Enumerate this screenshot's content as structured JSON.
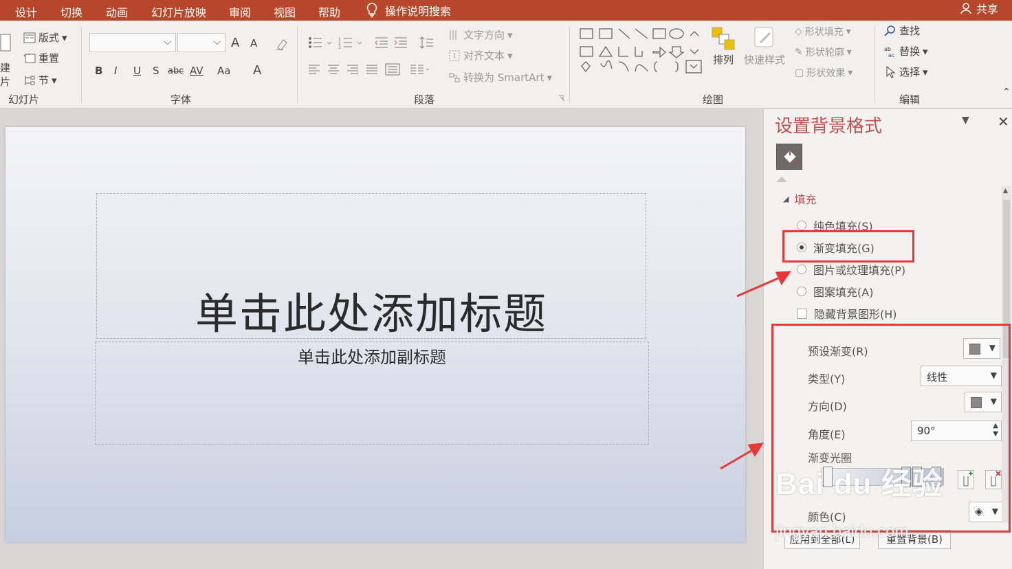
{
  "menu": {
    "tabs": [
      "设计",
      "切换",
      "动画",
      "幻灯片放映",
      "审阅",
      "视图",
      "帮助"
    ],
    "search_label": "操作说明搜索",
    "share_label": "共享"
  },
  "ribbon": {
    "slides": {
      "layout": "版式",
      "reset": "重置",
      "section": "节",
      "new_slide_top": "建",
      "new_slide_bottom": "片",
      "group": "幻灯片"
    },
    "font": {
      "group": "字体",
      "bold": "B",
      "italic": "I",
      "underline": "U",
      "shadow": "S",
      "strike": "abc",
      "spacing": "AV",
      "case": "Aa",
      "color": "A",
      "grow": "A",
      "shrink": "A"
    },
    "paragraph": {
      "group": "段落",
      "text_direction": "文字方向",
      "align_text": "对齐文本",
      "smartart": "转换为 SmartArt"
    },
    "drawing": {
      "group": "绘图",
      "arrange": "排列",
      "quick_styles": "快速样式",
      "shape_fill": "形状填充",
      "shape_outline": "形状轮廓",
      "shape_effects": "形状效果"
    },
    "editing": {
      "group": "编辑",
      "find": "查找",
      "replace": "替换",
      "select": "选择"
    }
  },
  "slide": {
    "title_placeholder": "单击此处添加标题",
    "subtitle_placeholder": "单击此处添加副标题"
  },
  "pane": {
    "title": "设置背景格式",
    "section_fill": "填充",
    "options": [
      {
        "label": "纯色填充(S)",
        "selected": false
      },
      {
        "label": "渐变填充(G)",
        "selected": true
      },
      {
        "label": "图片或纹理填充(P)",
        "selected": false
      },
      {
        "label": "图案填充(A)",
        "selected": false
      }
    ],
    "hide_bg_label": "隐藏背景图形(H)",
    "preset_label": "预设渐变(R)",
    "type_label": "类型(Y)",
    "type_value": "线性",
    "direction_label": "方向(D)",
    "angle_label": "角度(E)",
    "angle_value": "90°",
    "stops_label": "渐变光圈",
    "color_label": "颜色(C)",
    "apply_all": "应用到全部(L)",
    "reset_bg": "重置背景(B)"
  },
  "watermark": {
    "logo": "Bai du 经验",
    "url": "jingyan.baidu.com"
  },
  "colors": {
    "accent": "#b7472a",
    "annotation": "#e53935",
    "pane_title": "#c0504d"
  }
}
